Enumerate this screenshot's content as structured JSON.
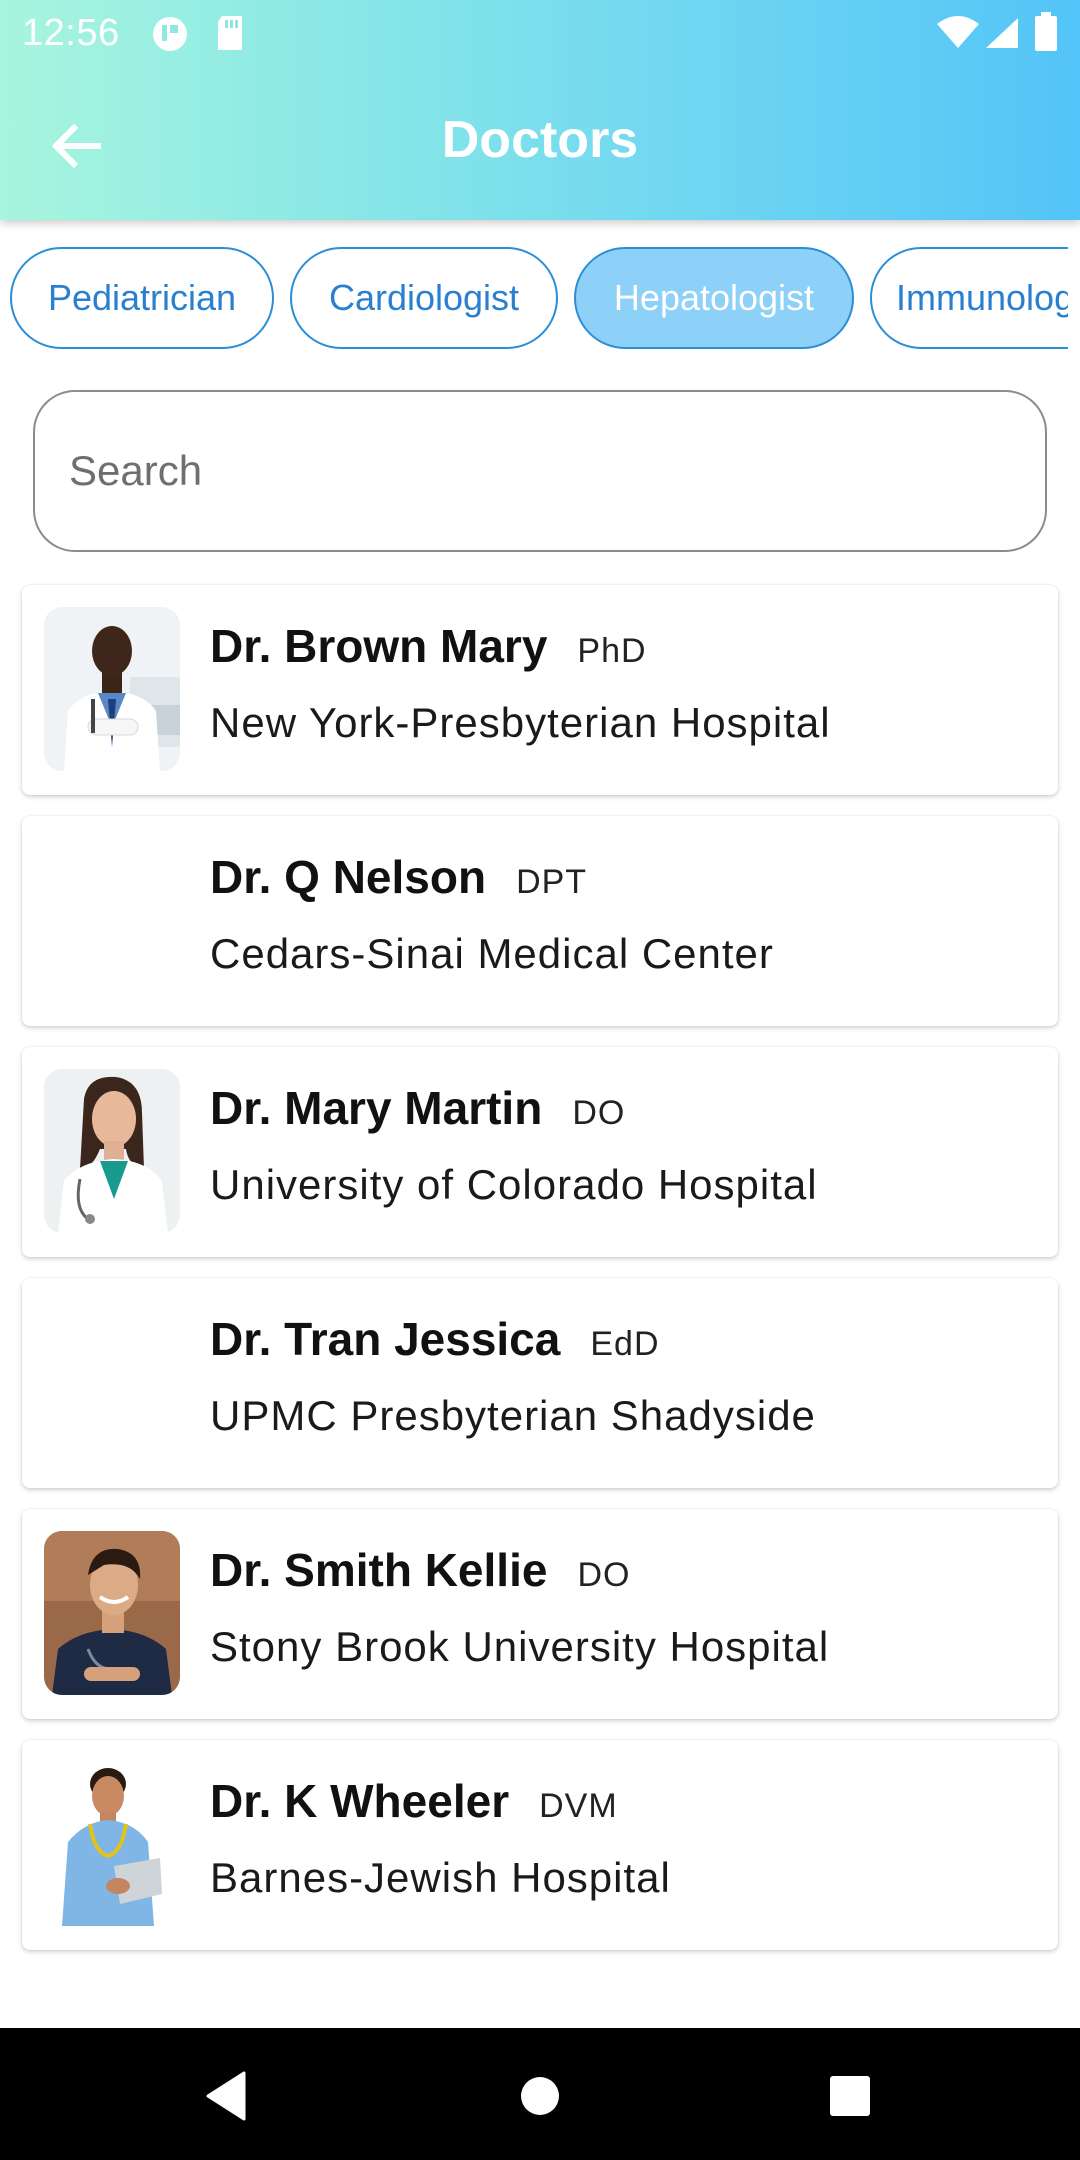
{
  "status_bar": {
    "time": "12:56"
  },
  "header": {
    "title": "Doctors",
    "back_icon": "arrow-left-icon"
  },
  "categories": [
    {
      "label": "Pediatrician",
      "active": false
    },
    {
      "label": "Cardiologist",
      "active": false
    },
    {
      "label": "Hepatologist",
      "active": true
    },
    {
      "label": "Immunologist",
      "active": false
    }
  ],
  "search": {
    "placeholder": "Search",
    "value": ""
  },
  "doctors": [
    {
      "name": "Dr. Brown Mary",
      "degree": "PhD",
      "hospital": "New York-Presbyterian Hospital",
      "has_photo": true
    },
    {
      "name": "Dr. Q Nelson",
      "degree": "DPT",
      "hospital": "Cedars-Sinai Medical Center",
      "has_photo": false
    },
    {
      "name": "Dr. Mary Martin",
      "degree": "DO",
      "hospital": "University of Colorado Hospital",
      "has_photo": true
    },
    {
      "name": "Dr. Tran Jessica",
      "degree": "EdD",
      "hospital": "UPMC Presbyterian Shadyside",
      "has_photo": false
    },
    {
      "name": "Dr. Smith Kellie",
      "degree": "DO",
      "hospital": "Stony Brook University Hospital",
      "has_photo": true
    },
    {
      "name": "Dr. K Wheeler",
      "degree": "DVM",
      "hospital": "Barnes-Jewish Hospital",
      "has_photo": true
    }
  ],
  "colors": {
    "chip_border": "#2a8fd6",
    "chip_active_bg": "#8dd0f8",
    "header_gradient_start": "#a8f5de",
    "header_gradient_end": "#53c4f7"
  }
}
